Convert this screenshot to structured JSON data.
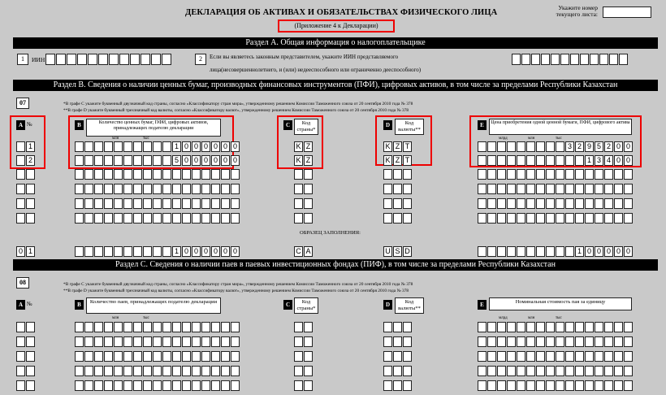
{
  "header": {
    "title": "ДЕКЛАРАЦИЯ ОБ АКТИВАХ И ОБЯЗАТЕЛЬСТВАХ ФИЗИЧЕСКОГО ЛИЦА",
    "subtitle": "(Приложение 4 к Декларации)",
    "sheet_label": "Укажите номер текущего листа:"
  },
  "section_a": {
    "title": "Раздел А. Общая информация о налогоплательщике",
    "field1_num": "1",
    "field1_label": "ИИН",
    "field2_num": "2",
    "field2_text1": "Если вы являетесь законным представителем, укажите ИИН представляемого",
    "field2_text2": "лица(несовершеннолетнего, и (или) недееспособного или ограниченно дееспособного)"
  },
  "section_b": {
    "title": "Раздел В. Сведения о наличии ценных бумаг, производных финансовых инструментов (ПФИ), цифровых активов, в том числе за пределами Республики Казахстан",
    "code": "07",
    "note1": "*В графе С укажите буквенный двузначный код страны, согласно «Классификатору стран мира», утвержденному решением Комиссии Таможенного союза от 20 сентября 2010 года № 378",
    "note2": "**В графе D укажите буквенный трехзначный код валюты, согласно «Классификатору валют», утвержденному решением Комиссии Таможенного союза от 20 сентября 2010 года № 378",
    "col_a": "№",
    "col_b": "Количество ценных бумаг, ПФИ, цифровых активов, принадлежащих подателю декларации",
    "col_c": "Код страны*",
    "col_d": "Код валюты**",
    "col_e": "Цена приобретения одной ценной бумаги, ПФИ, цифрового актива",
    "tiny_mln": "млн",
    "tiny_tys": "тыс",
    "tiny_mlrd": "млрд",
    "rows": [
      {
        "num": "1",
        "qty": [
          "1",
          "0",
          "0",
          "0",
          "0",
          "0",
          "0"
        ],
        "country": [
          "K",
          "Z"
        ],
        "currency": [
          "K",
          "Z",
          "T"
        ],
        "price": [
          "3",
          "2",
          "9",
          "5",
          "2",
          "0",
          "0"
        ]
      },
      {
        "num": "2",
        "qty": [
          "5",
          "0",
          "0",
          "0",
          "0",
          "0",
          "0"
        ],
        "country": [
          "K",
          "Z"
        ],
        "currency": [
          "K",
          "Z",
          "T"
        ],
        "price": [
          "1",
          "3",
          "4",
          "0",
          "0"
        ]
      }
    ],
    "sample_label": "ОБРАЗЕЦ ЗАПОЛНЕНИЯ:",
    "sample": {
      "num": [
        "0",
        "1"
      ],
      "qty": [
        "1",
        "0",
        "0",
        "0",
        "0",
        "0",
        "0"
      ],
      "country": [
        "C",
        "A"
      ],
      "currency": [
        "U",
        "S",
        "D"
      ],
      "price": [
        "1",
        "0",
        "0",
        "0",
        "0",
        "0"
      ]
    }
  },
  "section_c": {
    "title": "Раздел С. Сведения о наличии паев в паевых инвестиционных фондах (ПИФ), в том числе за пределами Республики Казахстан",
    "code": "08",
    "note1": "*В графе С укажите буквенный двузначный код страны, согласно «Классификатору стран мира», утвержденному решением Комиссии Таможенного союза от 20 сентября 2010 года № 378",
    "note2": "**В графе D укажите буквенный трехзначный код валюты, согласно «Классификатору валют», утвержденному решением Комиссии Таможенного союза от 20 сентября 2010 года № 378",
    "col_a": "№",
    "col_b": "Количество паев, принадлежащих подателю декларации",
    "col_c": "Код страны*",
    "col_d": "Код валюты**",
    "col_e": "Номинальная стоимость пая за единицу"
  },
  "letters": {
    "a": "A",
    "b": "B",
    "c": "C",
    "d": "D",
    "e": "E"
  },
  "colors": {
    "highlight": "#e00000",
    "background": "#c9c9c9"
  }
}
